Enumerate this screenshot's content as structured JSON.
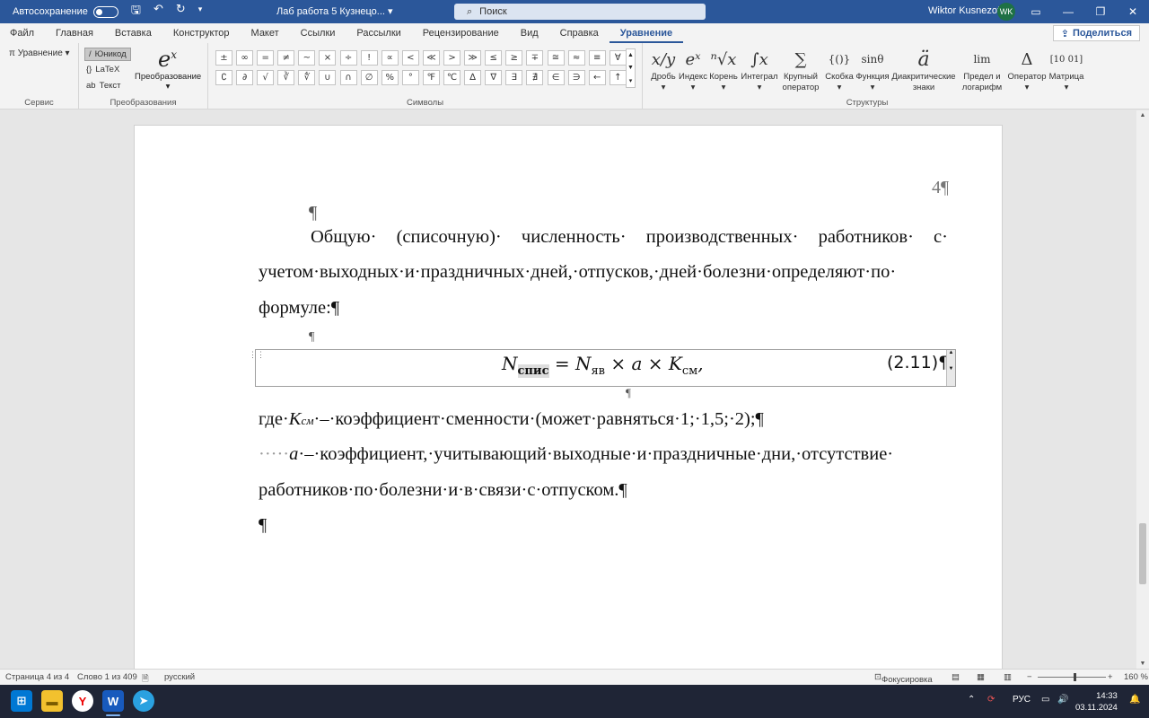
{
  "titlebar": {
    "autosave_label": "Автосохранение",
    "doc_title": "Лаб работа 5 Кузнецо...",
    "search_placeholder": "Поиск",
    "user_name": "Wiktor Kusnezoff",
    "user_initials": "WK"
  },
  "menu": {
    "tabs": [
      "Файл",
      "Главная",
      "Вставка",
      "Конструктор",
      "Макет",
      "Ссылки",
      "Рассылки",
      "Рецензирование",
      "Вид",
      "Справка",
      "Уравнение"
    ],
    "active_tab": "Уравнение",
    "share_label": "Поделиться"
  },
  "ribbon": {
    "service": {
      "equation_label": "Уравнение",
      "group_label": "Сервис"
    },
    "conversions": {
      "unicode_label": "Юникод",
      "latex_label": "LaTeX",
      "text_label": "Текст",
      "convert_label": "Преобразование",
      "group_label": "Преобразования"
    },
    "symbols": {
      "group_label": "Символы",
      "items": [
        "±",
        "∞",
        "=",
        "≠",
        "~",
        "×",
        "÷",
        "!",
        "∝",
        "<",
        "≪",
        ">",
        "≫",
        "≤",
        "≥",
        "∓",
        "≅",
        "≈",
        "≡",
        "∀",
        "∁",
        "∂",
        "√",
        "∛",
        "∜",
        "∪",
        "∩",
        "∅",
        "%",
        "°",
        "℉",
        "℃",
        "∆",
        "∇",
        "∃",
        "∄",
        "∈",
        "∋",
        "←",
        "↑"
      ]
    },
    "structures": {
      "group_label": "Структуры",
      "items": [
        {
          "label": "Дробь",
          "icon": "x/y"
        },
        {
          "label": "Индекс",
          "icon": "eˣ"
        },
        {
          "label": "Корень",
          "icon": "ⁿ√x"
        },
        {
          "label": "Интеграл",
          "icon": "∫x"
        },
        {
          "label": "Крупный оператор",
          "icon": "∑"
        },
        {
          "label": "Скобка",
          "icon": "{()}"
        },
        {
          "label": "Функция",
          "icon": "sinθ"
        },
        {
          "label": "Диакритические знаки",
          "icon": "ä"
        },
        {
          "label": "Предел и логарифм",
          "icon": "lim"
        },
        {
          "label": "Оператор",
          "icon": "Δ"
        },
        {
          "label": "Матрица",
          "icon": "[10 01]"
        }
      ]
    }
  },
  "document": {
    "page_number": "4¶",
    "para1_line1": "Общую· (списочную)· численность· производственных· работников· с·",
    "para1_line2": "учетом·выходных·и·праздничных·дней,·отпусков,·дней·болезни·определяют·по·",
    "para1_line3": "формуле:¶",
    "formula_n": "N",
    "formula_sub1": "спис",
    "formula_eq": " = N",
    "formula_sub2": "яв",
    "formula_mid": " × a × K",
    "formula_sub3": "см",
    "formula_tail": ",",
    "formula_number": "(2.11)",
    "where_prefix": "где·",
    "where_k": "K",
    "where_k_sub": "см",
    "where_text": "·–·коэффициент·сменности·(может·равняться·1;·1,5;·2);¶",
    "line_a_prefix": "·····",
    "line_a_var": "a",
    "line_a_text": "·–·коэффициент,·учитывающий·выходные·и·праздничные·дни,·отсутствие·",
    "line_a_cont": "работников·по·болезни·и·в·связи·с·отпуском.¶",
    "pilcrow": "¶"
  },
  "status": {
    "page": "Страница 4 из 4",
    "words": "Слово 1 из 409",
    "language": "русский",
    "focus": "Фокусировка",
    "zoom": "160 %"
  },
  "taskbar": {
    "language": "РУС",
    "time": "14:33",
    "date": "03.11.2024"
  },
  "colors": {
    "titlebar": "#2b579a",
    "accent": "#2b579a",
    "taskbar": "#1f2536"
  }
}
